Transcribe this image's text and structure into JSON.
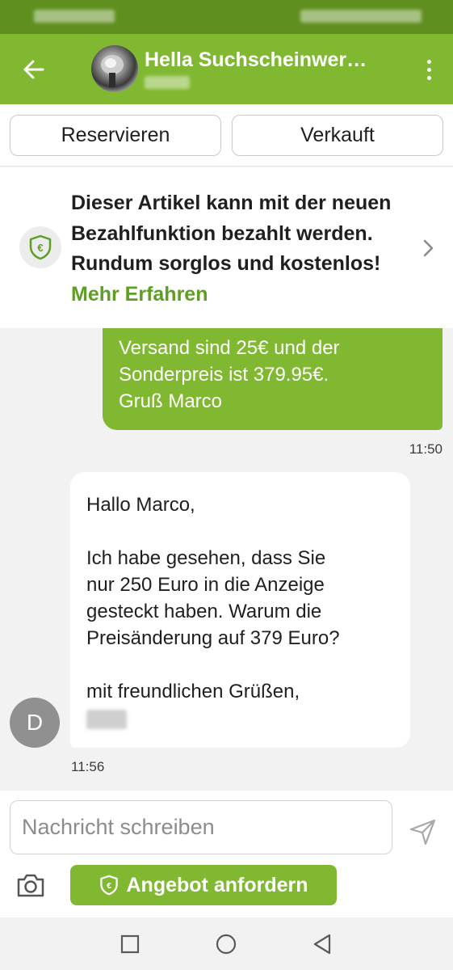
{
  "header": {
    "title": "Hella Suchscheinwer…",
    "back_icon": "arrow-left-icon",
    "menu_icon": "more-vertical-icon"
  },
  "actions": {
    "reserve_label": "Reservieren",
    "sold_label": "Verkauft"
  },
  "banner": {
    "icon": "euro-shield-icon",
    "text": "Dieser Artikel kann mit der neuen Bezahlfunktion bezahlt werden. Rundum sorglos und kostenlos!",
    "link": "Mehr Erfahren"
  },
  "messages": [
    {
      "direction": "outgoing",
      "lines": [
        "Versand sind 25€ und der",
        "Sonderpreis ist 379.95€.",
        "Gruß Marco"
      ],
      "time": "11:50"
    },
    {
      "direction": "incoming",
      "avatar_letter": "D",
      "greeting": "Hallo Marco,",
      "body_lines": [
        "Ich habe gesehen, dass Sie",
        "nur 250 Euro in die Anzeige",
        "gesteckt haben. Warum die",
        "Preisänderung auf 379 Euro?"
      ],
      "closing": "mit freundlichen Grüßen,",
      "time": "11:56"
    }
  ],
  "composer": {
    "placeholder": "Nachricht schreiben",
    "send_icon": "send-icon",
    "camera_icon": "camera-icon",
    "offer_label": "Angebot anfordern"
  },
  "navigation": {
    "recents_icon": "square-icon",
    "home_icon": "circle-icon",
    "back_icon": "triangle-back-icon"
  },
  "colors": {
    "brand_green": "#80b831",
    "status_bar": "#5f8f1e",
    "link_green": "#5e9e24"
  }
}
